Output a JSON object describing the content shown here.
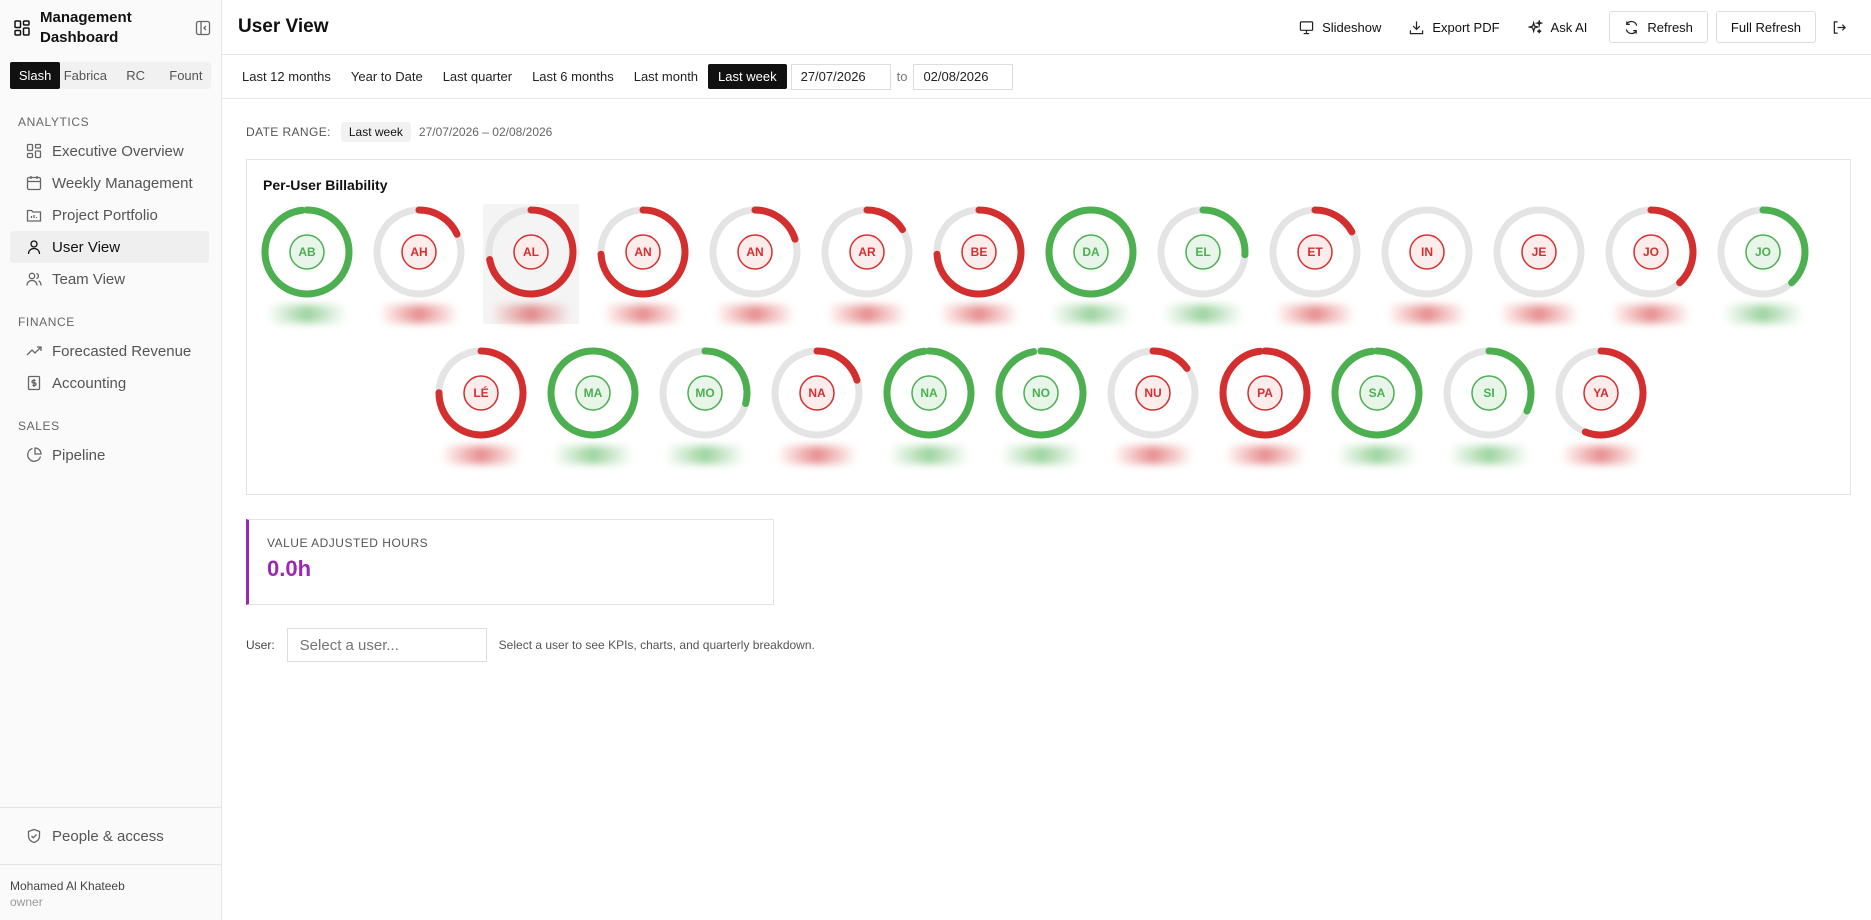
{
  "app": {
    "title": "Management Dashboard"
  },
  "workspaces": [
    {
      "label": "Slash",
      "active": true
    },
    {
      "label": "Fabrica",
      "active": false
    },
    {
      "label": "RC",
      "active": false
    },
    {
      "label": "Fount",
      "active": false
    }
  ],
  "nav": {
    "analytics_label": "ANALYTICS",
    "analytics": [
      "Executive Overview",
      "Weekly Management",
      "Project Portfolio",
      "User View",
      "Team View"
    ],
    "finance_label": "FINANCE",
    "finance": [
      "Forecasted Revenue",
      "Accounting"
    ],
    "sales_label": "SALES",
    "sales": [
      "Pipeline"
    ],
    "people": "People & access"
  },
  "user": {
    "name": "Mohamed Al Khateeb",
    "role": "owner"
  },
  "header": {
    "title": "User View",
    "slideshow": "Slideshow",
    "export": "Export PDF",
    "ask_ai": "Ask AI",
    "refresh": "Refresh",
    "full_refresh": "Full Refresh"
  },
  "filters": {
    "presets": [
      "Last 12 months",
      "Year to Date",
      "Last quarter",
      "Last 6 months",
      "Last month",
      "Last week"
    ],
    "active": "Last week",
    "from": "27/07/2026",
    "to_label": "to",
    "to": "02/08/2026"
  },
  "range": {
    "label": "DATE RANGE:",
    "chip": "Last week",
    "dates": "27/07/2026 – 02/08/2026"
  },
  "billability": {
    "title": "Per-User Billability",
    "users": [
      {
        "initials": "AB",
        "fill": 0.98,
        "status": "good"
      },
      {
        "initials": "AH",
        "fill": 0.18,
        "status": "bad"
      },
      {
        "initials": "AL",
        "fill": 0.72,
        "status": "bad"
      },
      {
        "initials": "AN",
        "fill": 0.74,
        "status": "bad"
      },
      {
        "initials": "AN",
        "fill": 0.2,
        "status": "bad"
      },
      {
        "initials": "AR",
        "fill": 0.16,
        "status": "bad"
      },
      {
        "initials": "BE",
        "fill": 0.74,
        "status": "bad"
      },
      {
        "initials": "DA",
        "fill": 1.0,
        "status": "good"
      },
      {
        "initials": "EL",
        "fill": 0.26,
        "status": "good"
      },
      {
        "initials": "ET",
        "fill": 0.17,
        "status": "bad"
      },
      {
        "initials": "IN",
        "fill": 0.0,
        "status": "bad"
      },
      {
        "initials": "JE",
        "fill": 0.0,
        "status": "bad"
      },
      {
        "initials": "JO",
        "fill": 0.38,
        "status": "bad"
      },
      {
        "initials": "JO",
        "fill": 0.38,
        "status": "good"
      },
      {
        "initials": "LÉ",
        "fill": 0.75,
        "status": "bad"
      },
      {
        "initials": "MA",
        "fill": 1.0,
        "status": "good"
      },
      {
        "initials": "MO",
        "fill": 0.29,
        "status": "good"
      },
      {
        "initials": "NA",
        "fill": 0.2,
        "status": "bad"
      },
      {
        "initials": "NA",
        "fill": 0.98,
        "status": "good"
      },
      {
        "initials": "NO",
        "fill": 0.97,
        "status": "good"
      },
      {
        "initials": "NU",
        "fill": 0.15,
        "status": "bad"
      },
      {
        "initials": "PA",
        "fill": 0.98,
        "status": "bad"
      },
      {
        "initials": "SA",
        "fill": 0.98,
        "status": "good"
      },
      {
        "initials": "SI",
        "fill": 0.32,
        "status": "good"
      },
      {
        "initials": "YA",
        "fill": 0.56,
        "status": "bad"
      }
    ]
  },
  "colors": {
    "good": "#4caf50",
    "bad": "#d32f2f",
    "track": "#e4e4e4",
    "accent": "#9c27b0"
  },
  "kpi": {
    "label": "VALUE ADJUSTED HOURS",
    "value": "0.0h"
  },
  "user_picker": {
    "label": "User:",
    "placeholder": "Select a user...",
    "hint": "Select a user to see KPIs, charts, and quarterly breakdown."
  }
}
